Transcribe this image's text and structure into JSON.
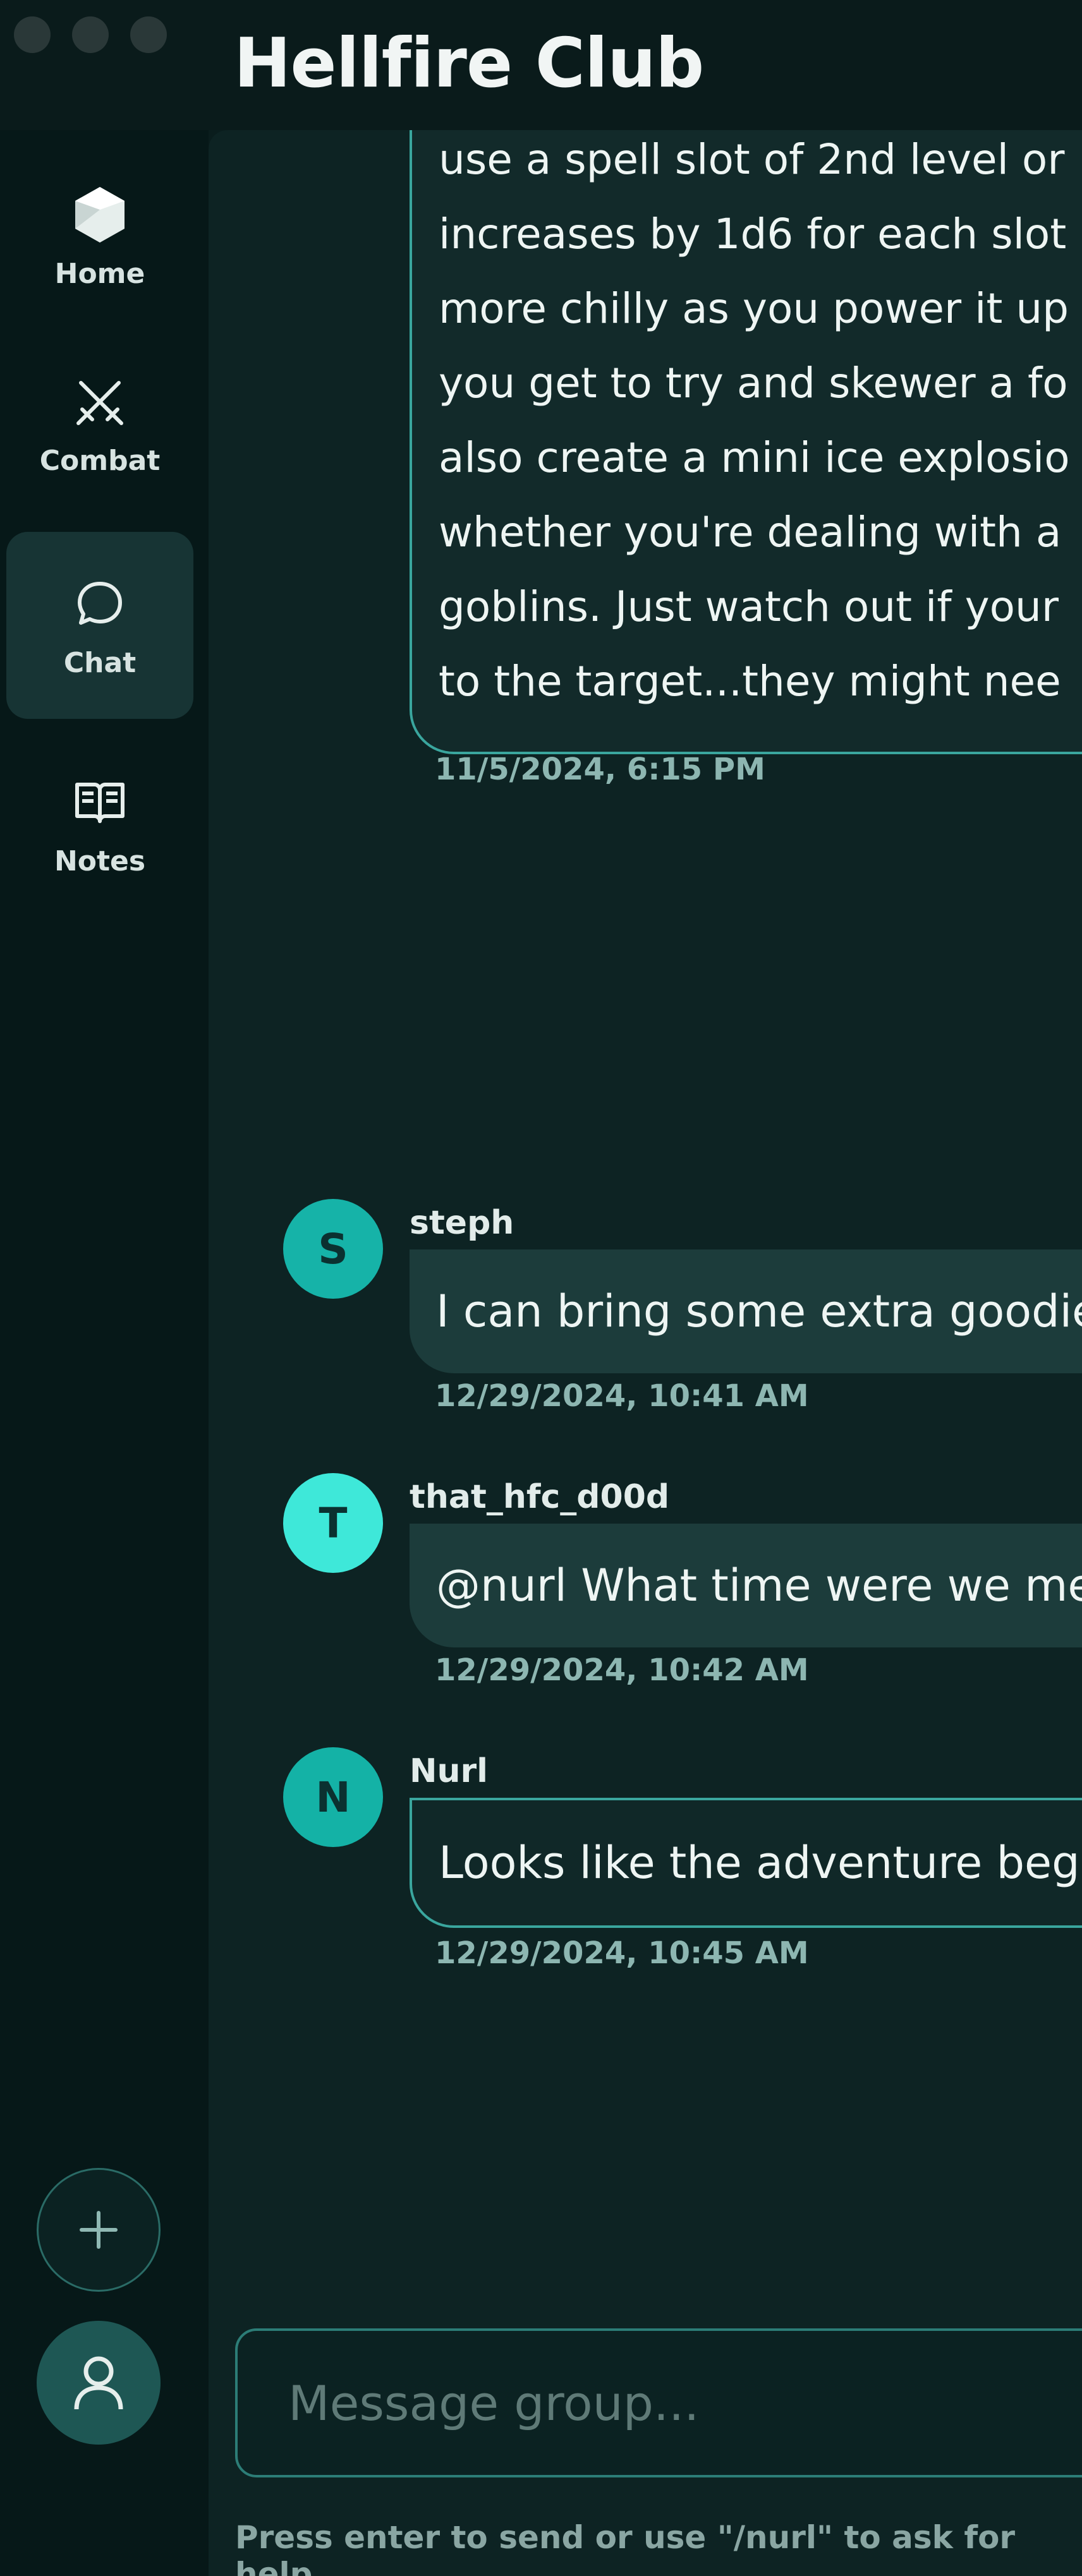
{
  "window": {
    "title": "Hellfire Club"
  },
  "sidebar": {
    "items": [
      {
        "label": "Home",
        "icon": "d20-icon"
      },
      {
        "label": "Combat",
        "icon": "crossed-swords-icon"
      },
      {
        "label": "Chat",
        "icon": "chat-bubble-icon",
        "active": true
      },
      {
        "label": "Notes",
        "icon": "open-book-icon"
      }
    ],
    "add_button_icon": "plus-icon",
    "profile_button_icon": "user-icon"
  },
  "chat": {
    "long_message": {
      "lines": [
        "use a spell slot of 2nd level or",
        "increases by 1d6 for each slot",
        "more chilly as you power it up",
        "you get to try and skewer a fo",
        "also create a mini ice explosio",
        "whether you're dealing with a",
        "goblins. Just watch out if your",
        "to the target...they might nee"
      ],
      "timestamp": "11/5/2024, 6:15 PM"
    },
    "messages": [
      {
        "initial": "S",
        "sender": "steph",
        "text": "I can bring some extra goodie",
        "timestamp": "12/29/2024, 10:41 AM",
        "avatar_color": "#16b3a8"
      },
      {
        "initial": "T",
        "sender": "that_hfc_d00d",
        "text": "@nurl What time were we me",
        "timestamp": "12/29/2024, 10:42 AM",
        "avatar_color": "#3ee8d9"
      },
      {
        "initial": "N",
        "sender": "Nurl",
        "text": "Looks like the adventure begi",
        "timestamp": "12/29/2024, 10:45 AM",
        "avatar_color": "#14b2a6"
      }
    ]
  },
  "composer": {
    "placeholder": "Message group...",
    "hint": "Press enter to send or use \"/nurl\" to ask for help"
  },
  "colors": {
    "accent": "#3aa69e",
    "background": "#0a1d1d"
  }
}
